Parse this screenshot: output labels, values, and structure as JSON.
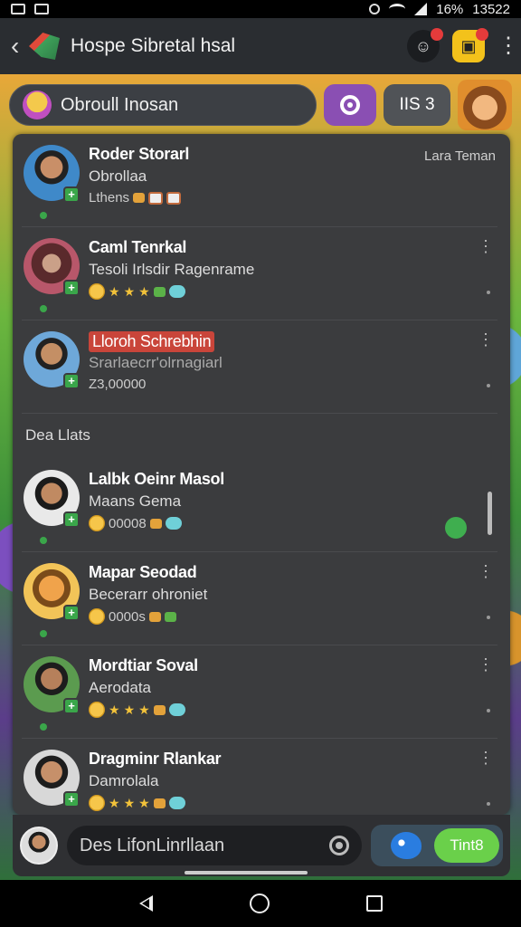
{
  "status_bar": {
    "battery": "16%",
    "time": "13522"
  },
  "app_bar": {
    "title": "Hospe Sibretal hsal",
    "notif_badge_1": "",
    "notif_badge_2": ""
  },
  "search": {
    "text": "Obroull Inosan",
    "count_label": "IIS 3"
  },
  "friends_online": [
    {
      "name": "Roder Storarl",
      "sub": "Obrollaa",
      "line3": "Lthens",
      "right_label": "Lara Teman",
      "icons": [
        "chip",
        "badge",
        "badge"
      ]
    },
    {
      "name": "Caml Tenrkal",
      "sub": "Tesoli Irlsdir Ragenrame",
      "line3": "",
      "right_label": "",
      "icons": [
        "face",
        "star",
        "star",
        "star",
        "bubble"
      ]
    },
    {
      "name": "Lloroh Schrebhin",
      "sub": "Srarlaecrr'olrnagiarl",
      "line3": "Z3,00000",
      "right_label": "",
      "icons": []
    }
  ],
  "section_label": "Dea Llats",
  "friends_other": [
    {
      "name": "Lalbk Oeinr Masol",
      "sub": "Maans Gema",
      "line3": "00008"
    },
    {
      "name": "Mapar Seodad",
      "sub": "Becerarr ohroniet",
      "line3": "0000s"
    },
    {
      "name": "Mordtiar Soval",
      "sub": "Aerodata",
      "line3": ""
    },
    {
      "name": "Dragminr Rlankar",
      "sub": "Damrolala",
      "line3": ""
    }
  ],
  "composer": {
    "placeholder": "Des LifonLinrllaan",
    "send_label": "Tint8"
  }
}
